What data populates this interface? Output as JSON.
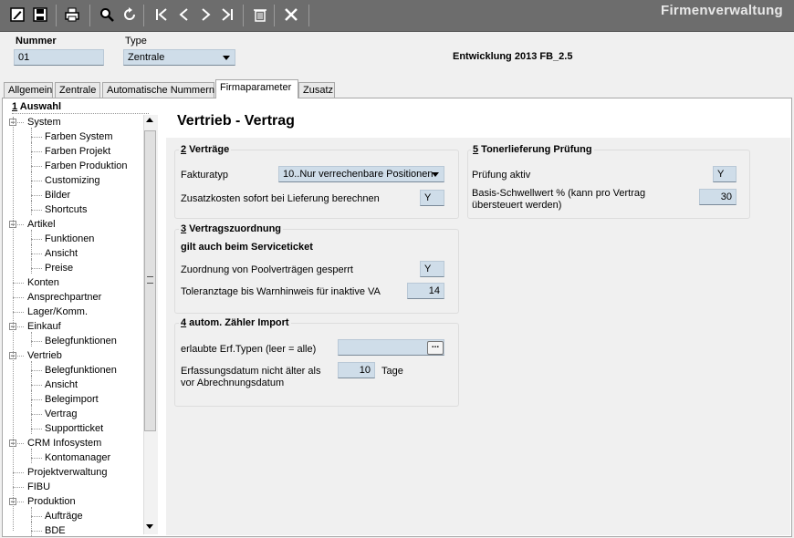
{
  "window": {
    "title": "Firmenverwaltung"
  },
  "toolbar": {
    "buttons": [
      "edit-icon",
      "save-icon",
      "print-icon",
      "search-icon",
      "refresh-icon",
      "first-record-icon",
      "previous-record-icon",
      "next-record-icon",
      "last-record-icon",
      "delete-icon",
      "close-icon"
    ]
  },
  "header": {
    "nummer_label": "Nummer",
    "nummer_value": "01",
    "type_label": "Type",
    "type_value": "Zentrale",
    "version_text": "Entwicklung 2013 FB_2.5"
  },
  "tabs": [
    {
      "label": "Allgemein",
      "active": false
    },
    {
      "label": "Zentrale",
      "active": false
    },
    {
      "label": "Automatische Nummern",
      "active": false
    },
    {
      "label": "Firmaparameter",
      "active": true
    },
    {
      "label": "Zusatz",
      "active": false
    }
  ],
  "tree": {
    "header_num": "1",
    "header_text": " Auswahl",
    "items": [
      {
        "label": "System",
        "level": 0,
        "expanded": true
      },
      {
        "label": "Farben System",
        "level": 1
      },
      {
        "label": "Farben Projekt",
        "level": 1
      },
      {
        "label": "Farben Produktion",
        "level": 1
      },
      {
        "label": "Customizing",
        "level": 1
      },
      {
        "label": "Bilder",
        "level": 1
      },
      {
        "label": "Shortcuts",
        "level": 1
      },
      {
        "label": "Artikel",
        "level": 0,
        "expanded": true
      },
      {
        "label": "Funktionen",
        "level": 1
      },
      {
        "label": "Ansicht",
        "level": 1
      },
      {
        "label": "Preise",
        "level": 1
      },
      {
        "label": "Konten",
        "level": 0
      },
      {
        "label": "Ansprechpartner",
        "level": 0
      },
      {
        "label": "Lager/Komm.",
        "level": 0
      },
      {
        "label": "Einkauf",
        "level": 0,
        "expanded": true
      },
      {
        "label": "Belegfunktionen",
        "level": 1
      },
      {
        "label": "Vertrieb",
        "level": 0,
        "expanded": true
      },
      {
        "label": "Belegfunktionen",
        "level": 1
      },
      {
        "label": "Ansicht",
        "level": 1
      },
      {
        "label": "Belegimport",
        "level": 1
      },
      {
        "label": "Vertrag",
        "level": 1
      },
      {
        "label": "Supportticket",
        "level": 1
      },
      {
        "label": "CRM Infosystem",
        "level": 0,
        "expanded": true
      },
      {
        "label": "Kontomanager",
        "level": 1
      },
      {
        "label": "Projektverwaltung",
        "level": 0
      },
      {
        "label": "FIBU",
        "level": 0
      },
      {
        "label": "Produktion",
        "level": 0,
        "expanded": true
      },
      {
        "label": "Aufträge",
        "level": 1
      },
      {
        "label": "BDE",
        "level": 1
      }
    ]
  },
  "main": {
    "title": "Vertrieb - Vertrag",
    "groups": {
      "vertraege": {
        "num": "2",
        "title": " Verträge",
        "fakturatyp_label": "Fakturatyp",
        "fakturatyp_value": "10..Nur verrechenbare Positionen",
        "zusatzkosten_label": "Zusatzkosten sofort bei Lieferung berechnen",
        "zusatzkosten_value": "Y"
      },
      "zuordnung": {
        "num": "3",
        "title": " Vertragszuordnung",
        "subtitle": "gilt auch beim Serviceticket",
        "pool_label": "Zuordnung von Poolverträgen gesperrt",
        "pool_value": "Y",
        "toleranz_label": "Toleranztage bis Warnhinweis für inaktive VA",
        "toleranz_value": "14"
      },
      "zaehler": {
        "num": "4",
        "title": " autom. Zähler Import",
        "erf_label": "erlaubte Erf.Typen  (leer = alle)",
        "erf_value": "",
        "erf_button": "...",
        "datum_label_1": "Erfassungsdatum nicht älter als",
        "datum_label_2": "vor Abrechnungsdatum",
        "datum_value": "10",
        "datum_unit": "Tage"
      },
      "toner": {
        "num": "5",
        "title": " Tonerlieferung Prüfung",
        "aktiv_label": "Prüfung aktiv",
        "aktiv_value": "Y",
        "schwelle_label_1": "Basis-Schwellwert % (kann pro Vertrag",
        "schwelle_label_2": "übersteuert werden)",
        "schwelle_value": "30"
      }
    }
  }
}
